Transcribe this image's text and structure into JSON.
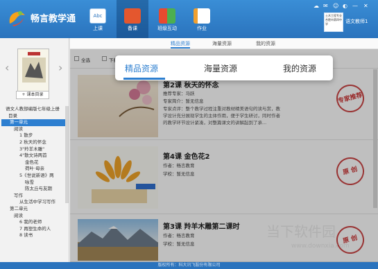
{
  "app": {
    "name": "畅言教学通",
    "user": "语文教师1",
    "user_box": "土木工程专业  合肥市第四中学"
  },
  "nav": [
    {
      "label": "上课",
      "icon": "abc-board-icon",
      "color": "#ffffff"
    },
    {
      "label": "备课",
      "icon": "book-icon",
      "color": "#e4572e"
    },
    {
      "label": "班级互动",
      "icon": "grid-icon",
      "color": "#4caf50"
    },
    {
      "label": "作业",
      "icon": "pencil-doc-icon",
      "color": "#f0a030"
    }
  ],
  "window_controls": [
    "☁",
    "✉",
    "☺",
    "◐",
    "—",
    "✕"
  ],
  "sidebar": {
    "add_btn": "+ 课本目录",
    "tree": [
      "语文人教部编版七年级上册",
      "目录",
      "第一单元",
      "阅读",
      "1 散步",
      "2 秋天的怀念",
      "3\"羚羊木雕\"",
      "4\"散文诗两首",
      "金色花",
      "荷叶·母亲",
      "5《世说新语》两",
      "咏雪",
      "陈太丘与友期",
      "写作",
      "从生活中学习写作",
      "第二单元",
      "阅读",
      "6 我的老师",
      "7 再塑生命的人",
      "8 读书"
    ]
  },
  "subtabs": [
    "精品资源",
    "海量资源",
    "我的资源"
  ],
  "toolbar": {
    "select_all": "全选",
    "download": "下载"
  },
  "popup": {
    "tabs": [
      "精品资源",
      "海量资源",
      "我的资源"
    ]
  },
  "cards": [
    {
      "title": "第2课 秋天的怀念",
      "meta1": "推荐专家：马跃",
      "meta2": "专家简介：暂无信息",
      "desc": "专家点评：整个教学过程注重对教材精美语句的读与赏，教学设计充分展现学生的主体作用，便于学生研讨，同时作者的教学环节设计紧凑，对整篇课文的讲解起到了承...",
      "stamp": "专家推荐"
    },
    {
      "title": "第4课 金色花2",
      "meta1": "作者：畅言教育",
      "meta2": "学校：暂无信息",
      "stamp": "原 创"
    },
    {
      "title": "第3课 羚羊木雕第二课时",
      "meta1": "作者：畅言教育",
      "meta2": "学校：暂无信息",
      "stamp": "原 创"
    }
  ],
  "footer": "版权所有：科大讯飞股份有限公司",
  "watermark": "当下软件园",
  "watermark2": "www.downxia.com"
}
